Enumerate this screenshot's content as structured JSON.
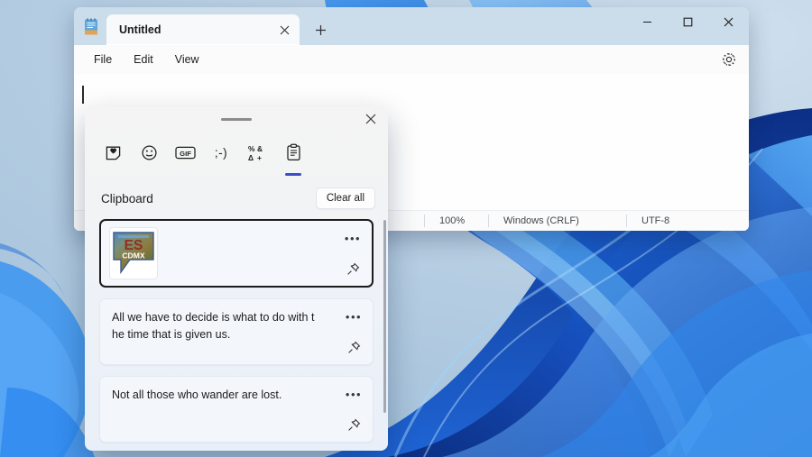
{
  "desktop": {
    "wallpaper_name": "windows-11-bloom-blue",
    "colors": {
      "pale": "#c3d6e8",
      "mid": "#1f63d2",
      "deep": "#0b2f86",
      "bright": "#2f8ff0"
    }
  },
  "notepad": {
    "app_icon": "notepad-icon",
    "tab": {
      "label": "Untitled",
      "close_icon": "close-icon"
    },
    "new_tab_icon": "plus-icon",
    "window_controls": {
      "minimize_icon": "minimize-icon",
      "maximize_icon": "maximize-icon",
      "close_icon": "close-icon"
    },
    "menu": [
      {
        "label": "File",
        "name": "menu-file"
      },
      {
        "label": "Edit",
        "name": "menu-edit"
      },
      {
        "label": "View",
        "name": "menu-view"
      }
    ],
    "settings_icon": "gear-icon",
    "editor": {
      "value": "",
      "placeholder": ""
    },
    "statusbar": {
      "position": "",
      "zoom": "100%",
      "line_endings": "Windows (CRLF)",
      "encoding": "UTF-8"
    }
  },
  "emoji_panel": {
    "drag_handle": "drag-handle",
    "close_label": "Close",
    "close_icon": "close-icon",
    "categories": [
      {
        "name": "tab-recent-stickers",
        "icon": "sticker-heart-icon",
        "glyph": "",
        "active": false
      },
      {
        "name": "tab-emoji",
        "icon": "smiley-face-icon",
        "glyph": "",
        "active": false
      },
      {
        "name": "tab-gif",
        "icon": "gif-badge-icon",
        "glyph": "GIF",
        "active": false
      },
      {
        "name": "tab-kaomoji",
        "icon": "kaomoji-icon",
        "glyph": ";-)",
        "active": false
      },
      {
        "name": "tab-symbols",
        "icon": "symbols-icon",
        "glyph": "",
        "active": false
      },
      {
        "name": "tab-clipboard",
        "icon": "clipboard-icon",
        "glyph": "",
        "active": true
      }
    ],
    "section_title": "Clipboard",
    "clear_all_label": "Clear all",
    "accent_color": "#3b4cca",
    "items": [
      {
        "type": "image",
        "name": "clipboard-item-image",
        "text": "",
        "thumbnail": {
          "alt": "ES CDMX logo",
          "top_text": "ES",
          "bottom_text": "CDMX"
        },
        "focused": true,
        "more_icon": "more-options-icon",
        "pin_icon": "pin-icon"
      },
      {
        "type": "text",
        "name": "clipboard-item-text",
        "text": "All we have to decide is what to do with the time that is given us.",
        "focused": false,
        "more_icon": "more-options-icon",
        "pin_icon": "pin-icon"
      },
      {
        "type": "text",
        "name": "clipboard-item-text",
        "text": "Not all those who wander are lost.",
        "focused": false,
        "more_icon": "more-options-icon",
        "pin_icon": "pin-icon"
      }
    ],
    "more_glyph": "•••"
  }
}
